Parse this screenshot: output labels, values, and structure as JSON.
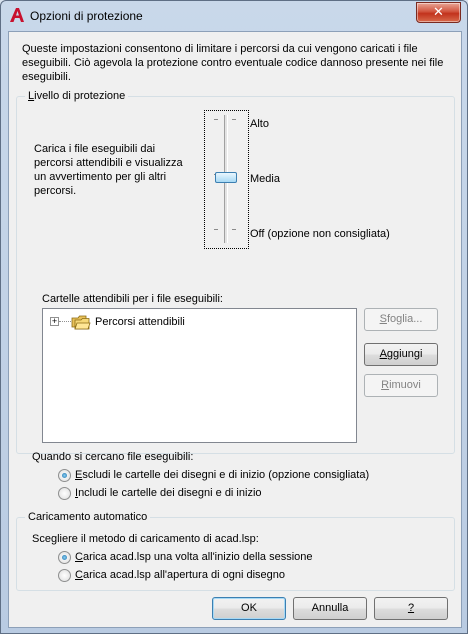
{
  "window": {
    "title": "Opzioni di protezione",
    "close_glyph": "✕",
    "app_icon": "autocad-a-icon"
  },
  "intro_text": "Queste impostazioni consentono di limitare i percorsi da cui vengono caricati i file eseguibili. Ciò agevola la protezione contro eventuale codice dannoso presente nei file eseguibili.",
  "security_level": {
    "group_label_first": "L",
    "group_label_rest": "ivello di protezione",
    "description": "Carica i file eseguibili dai percorsi attendibili e visualizza un avvertimento per gli altri percorsi.",
    "levels": [
      "Alto",
      "Media",
      "Off (opzione non consigliata)"
    ],
    "selected": "Media"
  },
  "trusted_folders": {
    "label": "Cartelle attendibili per i file eseguibili:",
    "tree_items": [
      {
        "label": "Percorsi attendibili",
        "expander": "+",
        "icon": "folder-icon"
      }
    ],
    "browse_first": "S",
    "browse_rest": "foglia...",
    "add_first": "A",
    "add_rest": "ggiungi",
    "remove_first": "R",
    "remove_rest": "imuovi"
  },
  "search_options": {
    "label": "Quando si cercano file eseguibili:",
    "opt1_first": "E",
    "opt1_rest": "scludi le cartelle dei disegni e di inizio (opzione consigliata)",
    "opt2_first": "I",
    "opt2_rest": "ncludi le cartelle dei disegni e di inizio",
    "selected": 0
  },
  "autoload": {
    "group_label": "Caricamento automatico",
    "prompt": "Scegliere il metodo di caricamento di acad.lsp:",
    "opt1_first": "C",
    "opt1_rest": "arica acad.lsp una volta all'inizio della sessione",
    "opt2_first": "C",
    "opt2_rest": "arica acad.lsp all'apertura di ogni disegno",
    "selected": 0
  },
  "footer": {
    "ok": "OK",
    "cancel": "Annulla",
    "help": "?"
  },
  "colors": {
    "title_bar": "#c9d8ea",
    "client_bg": "#f0f0f0",
    "close": "#c2321c",
    "app_icon": "#c8102e"
  }
}
